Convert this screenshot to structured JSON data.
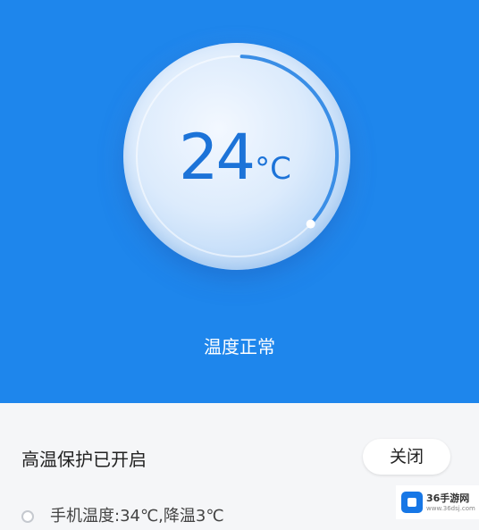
{
  "dial": {
    "temperature": "24",
    "unit": "°C",
    "progress_fraction": 0.36
  },
  "status": "温度正常",
  "protection": {
    "title": "高温保护已开启",
    "close_label": "关闭"
  },
  "info": {
    "text": "手机温度:34℃,降温3℃"
  },
  "watermark": {
    "name": "36手游网",
    "sub": "www.36dsj.com"
  },
  "colors": {
    "accent": "#1e86ec",
    "dial_text": "#1c73d8"
  },
  "icons": {
    "info_row": "circle-outline-icon",
    "watermark": "cube-logo-icon"
  }
}
